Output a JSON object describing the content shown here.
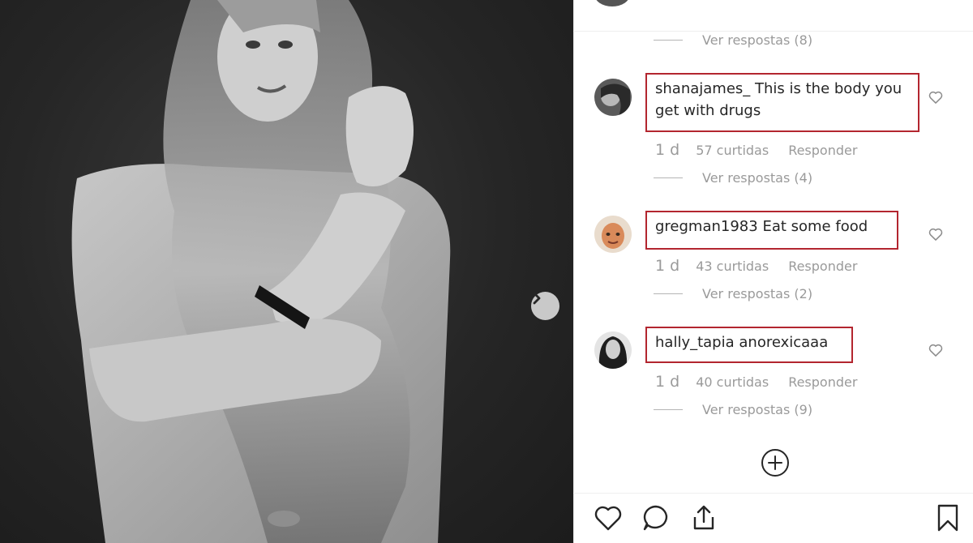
{
  "post": {
    "next_icon": "chevron-right-icon"
  },
  "thread": {
    "top_replies_label": "Ver respostas (8)"
  },
  "comments": [
    {
      "username": "shanajames_",
      "text": "This is the body you get with drugs",
      "time": "1 d",
      "likes": "57 curtidas",
      "reply_label": "Responder",
      "view_replies": "Ver respostas (4)"
    },
    {
      "username": "gregman1983",
      "text": "Eat some food",
      "time": "1 d",
      "likes": "43 curtidas",
      "reply_label": "Responder",
      "view_replies": "Ver respostas (2)"
    },
    {
      "username": "hally_tapia",
      "text": "anorexicaaa",
      "time": "1 d",
      "likes": "40 curtidas",
      "reply_label": "Responder",
      "view_replies": "Ver respostas (9)"
    }
  ],
  "colors": {
    "highlight_border": "#b3262f",
    "muted_text": "#9a9a9a",
    "primary_text": "#262626"
  },
  "action_bar": {
    "icons": [
      "heart-icon",
      "comment-icon",
      "share-icon",
      "bookmark-icon"
    ]
  }
}
